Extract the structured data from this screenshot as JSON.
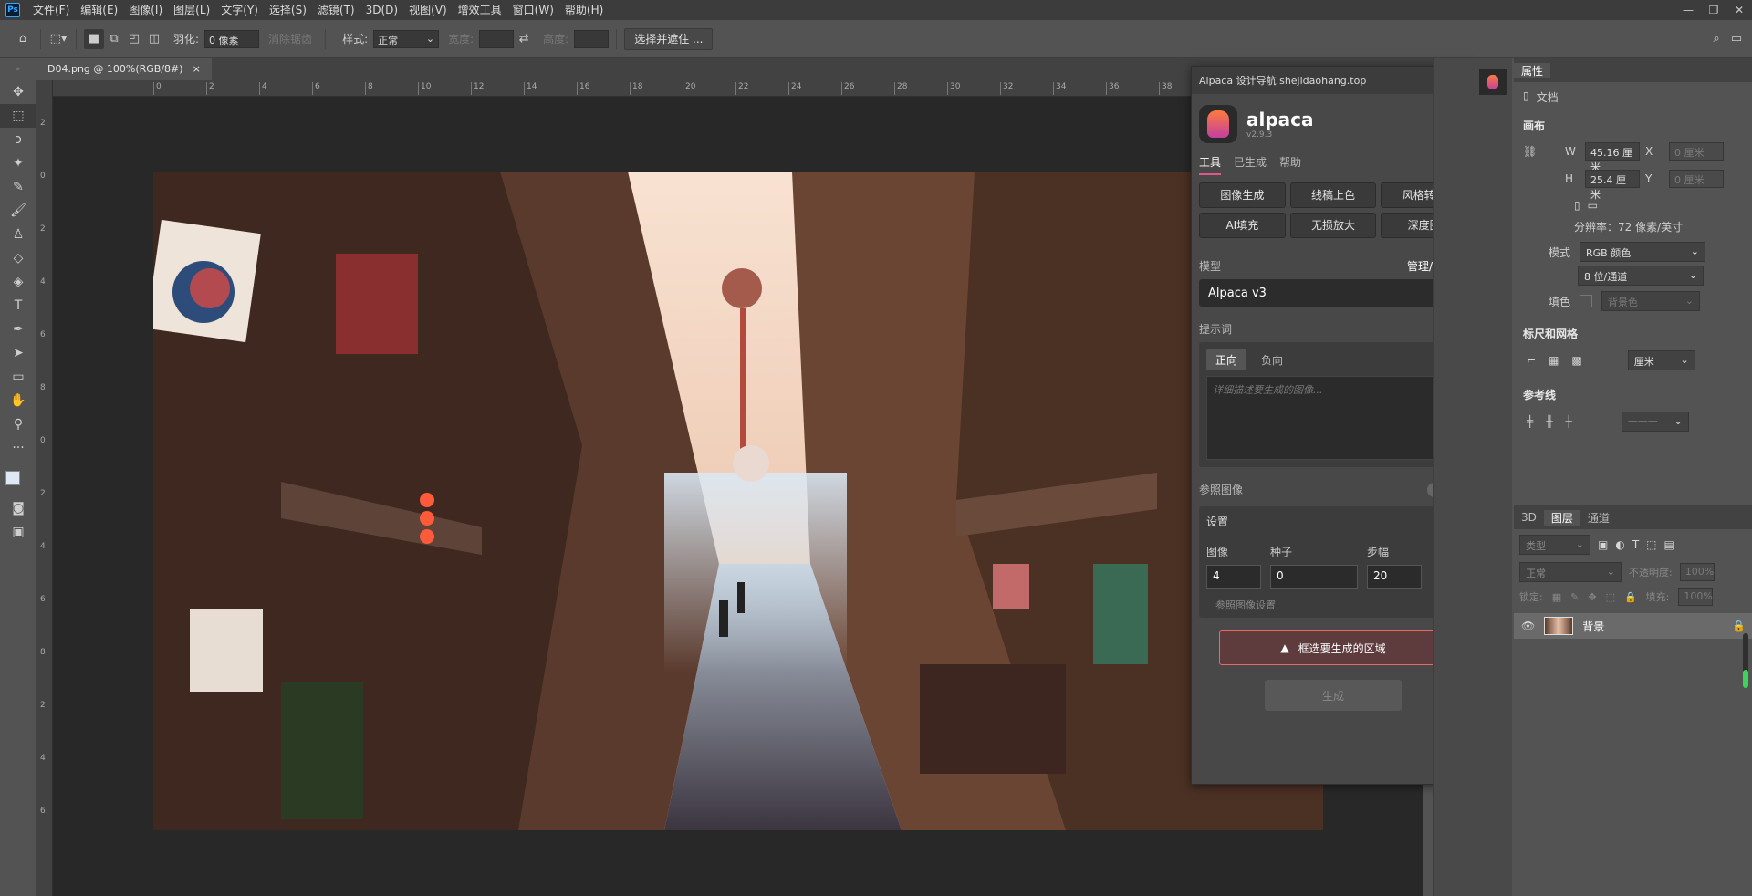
{
  "menubar": {
    "logo": "Ps",
    "items": [
      "文件(F)",
      "编辑(E)",
      "图像(I)",
      "图层(L)",
      "文字(Y)",
      "选择(S)",
      "滤镜(T)",
      "3D(D)",
      "视图(V)",
      "增效工具",
      "窗口(W)",
      "帮助(H)"
    ],
    "winctl": [
      "—",
      "❐",
      "✕"
    ]
  },
  "options": {
    "feather_label": "羽化:",
    "feather_value": "0 像素",
    "antialias_label": "消除锯齿",
    "style_label": "样式:",
    "style_value": "正常",
    "width_label": "宽度:",
    "height_label": "高度:",
    "select_mask_button": "选择并遮住 ..."
  },
  "document": {
    "tab_title": "D04.png @ 100%(RGB/8#)",
    "tab_close": "×"
  },
  "ruler": {
    "h_ticks": [
      "0",
      "2",
      "4",
      "6",
      "8",
      "10",
      "12",
      "14",
      "16",
      "18",
      "20",
      "22",
      "24",
      "26",
      "28",
      "30",
      "32",
      "34",
      "36",
      "38"
    ],
    "v_ticks": [
      "2",
      "0",
      "2",
      "4",
      "6",
      "8",
      "0",
      "2",
      "4",
      "6",
      "8",
      "2",
      "4",
      "6"
    ]
  },
  "plugin": {
    "title": "Alpaca 设计导航 shejidaohang.top",
    "brand": "alpaca",
    "version": "v2.9.3",
    "tabs": [
      "工具",
      "已生成",
      "帮助"
    ],
    "tools": [
      "图像生成",
      "线稿上色",
      "风格转换",
      "AI填充",
      "无损放大",
      "深度图"
    ],
    "model_label": "模型",
    "model_manage": "管理/创建",
    "model_value": "Alpaca v3",
    "prompt_label": "提示词",
    "prompt_tab_pos": "正向",
    "prompt_tab_neg": "负向",
    "prompt_placeholder": "详细描述要生成的图像...",
    "ref_label": "参照图像",
    "settings_label": "设置",
    "images_label": "图像",
    "images_value": "4",
    "seed_label": "种子",
    "seed_value": "0",
    "steps_label": "步幅",
    "steps_value": "20",
    "ref_settings_label": "参照图像设置",
    "warning": "框选要生成的区域",
    "generate_button": "生成"
  },
  "properties": {
    "tab": "属性",
    "doc_label": "文档",
    "canvas_label": "画布",
    "w_label": "W",
    "w_value": "45.16 厘米",
    "h_label": "H",
    "h_value": "25.4 厘米",
    "x_label": "X",
    "x_value": "0 厘米",
    "y_label": "Y",
    "y_value": "0 厘米",
    "resolution": "分辨率：72 像素/英寸",
    "mode_label": "模式",
    "mode_value": "RGB 颜色",
    "depth_value": "8 位/通道",
    "fill_label": "填色",
    "fill_value": "背景色",
    "rulers_label": "标尺和网格",
    "unit_value": "厘米",
    "guides_label": "参考线"
  },
  "layers": {
    "tabs": [
      "3D",
      "图层",
      "通道"
    ],
    "filter_value": "类型",
    "blend_value": "正常",
    "opacity_label": "不透明度:",
    "opacity_value": "100%",
    "lock_label": "锁定:",
    "fill_label": "填充:",
    "fill_value": "100%",
    "layer_name": "背景"
  }
}
